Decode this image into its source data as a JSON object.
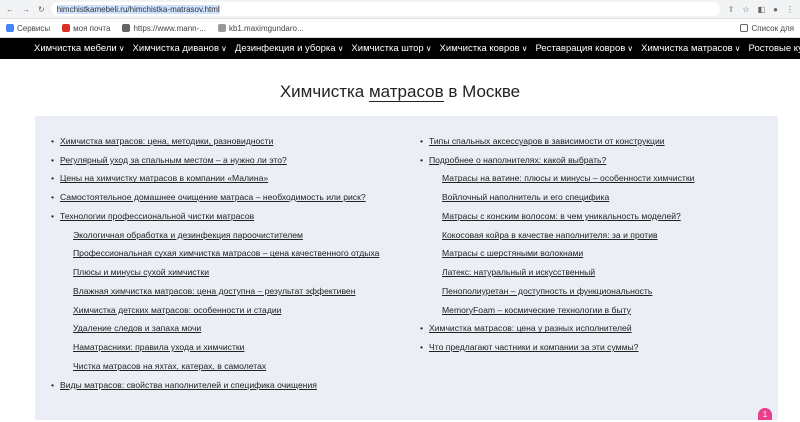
{
  "browser": {
    "url": "himchistkamebeli.ru/himchistka-matrasov.html",
    "bookmarks": [
      {
        "label": "Сервисы",
        "icon": "grid-icon",
        "color": "#4285f4"
      },
      {
        "label": "моя почта",
        "icon": "mail-icon",
        "color": "#d93025"
      },
      {
        "label": "https://www.mann-...",
        "icon": "globe-icon",
        "color": "#666666"
      },
      {
        "label": "kb1.maximgundaro...",
        "icon": "page-icon",
        "color": "#999999"
      }
    ],
    "reading_list": "Список для"
  },
  "menu": [
    "Химчистка мебели",
    "Химчистка диванов",
    "Дезинфекция и уборка",
    "Химчистка штор",
    "Химчистка ковров",
    "Реставрация ковров",
    "Химчистка матрасов",
    "Ростовые куклы"
  ],
  "page": {
    "title_before": "Химчистка ",
    "title_highlight": "матрасов",
    "title_after": " в Москве"
  },
  "toc_left": [
    {
      "text": "Химчистка матрасов: цена, методики, разновидности",
      "level": 1
    },
    {
      "text": "Регулярный уход за спальным местом – а нужно ли это?",
      "level": 1
    },
    {
      "text": "Цены на химчистку матрасов в компании «Малина»",
      "level": 1
    },
    {
      "text": "Самостоятельное домашнее очищение матраса – необходимость или риск?",
      "level": 1
    },
    {
      "text": "Технологии профессиональной чистки матрасов",
      "level": 1
    },
    {
      "text": "Экологичная обработка и дезинфекция пароочистителем",
      "level": 2
    },
    {
      "text": "Профессиональная сухая химчистка матрасов – цена качественного отдыха",
      "level": 2
    },
    {
      "text": "Плюсы и минусы сухой химчистки",
      "level": 2
    },
    {
      "text": "Влажная химчистка матрасов: цена доступна – результат эффективен",
      "level": 2
    },
    {
      "text": "Химчистка детских матрасов: особенности и стадии",
      "level": 2
    },
    {
      "text": "Удаление следов и запаха мочи",
      "level": 2
    },
    {
      "text": "Наматрасники: правила ухода и химчистки",
      "level": 2
    },
    {
      "text": "Чистка матрасов на яхтах, катерах, в самолетах",
      "level": 2
    },
    {
      "text": "Виды матрасов: свойства наполнителей и специфика очищения",
      "level": 1
    }
  ],
  "toc_right": [
    {
      "text": "Типы спальных аксессуаров в зависимости от конструкции",
      "level": 1
    },
    {
      "text": "Подробнее о наполнителях: какой выбрать?",
      "level": 1
    },
    {
      "text": "Матрасы на ватине: плюсы и минусы – особенности химчистки",
      "level": 2
    },
    {
      "text": "Войлочный наполнитель и его специфика",
      "level": 2
    },
    {
      "text": "Матрасы с конским волосом: в чем уникальность моделей?",
      "level": 2
    },
    {
      "text": "Кокосовая койра в качестве наполнителя: за и против",
      "level": 2
    },
    {
      "text": "Матрасы с шерстяными волокнами",
      "level": 2
    },
    {
      "text": "Латекс: натуральный и искусственный",
      "level": 2
    },
    {
      "text": "Пенополиуретан – доступность и функциональность",
      "level": 2
    },
    {
      "text": "MemoryFoam – космические технологии в быту",
      "level": 2
    },
    {
      "text": "Химчистка матрасов: цена у разных исполнителей",
      "level": 1
    },
    {
      "text": "Что предлагают частники и компании за эти суммы?",
      "level": 1
    }
  ],
  "fab": "1",
  "colors": {
    "menu_bg": "#000000",
    "toc_bg": "#eceef6",
    "fab": "#e83e8c"
  }
}
